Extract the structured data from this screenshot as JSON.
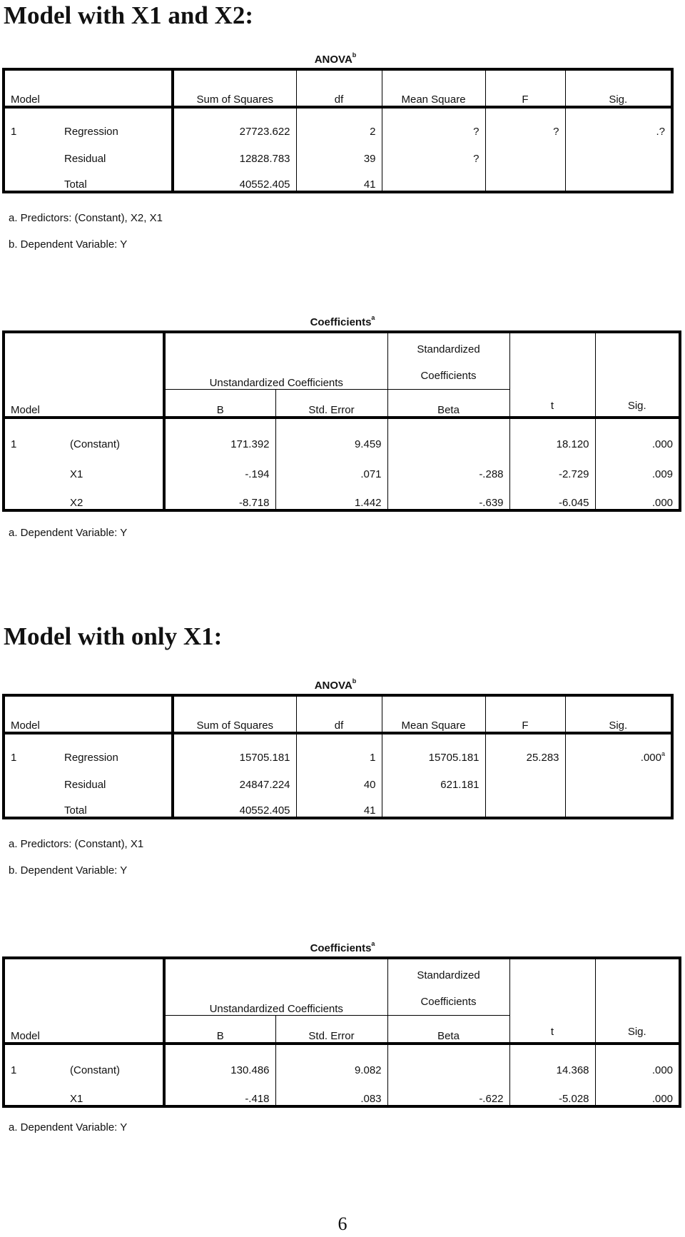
{
  "section1": {
    "heading": "Model with X1 and X2:",
    "anova": {
      "caption": "ANOVA",
      "caption_sup": "b",
      "headers": [
        "Model",
        "Sum of Squares",
        "df",
        "Mean Square",
        "F",
        "Sig."
      ],
      "rows": [
        {
          "model": "1",
          "term": "Regression",
          "ss": "27723.622",
          "df": "2",
          "ms": "?",
          "f": "?",
          "sig": ".?",
          "sig_sup": ""
        },
        {
          "model": "",
          "term": "Residual",
          "ss": "12828.783",
          "df": "39",
          "ms": "?",
          "f": "",
          "sig": "",
          "sig_sup": ""
        },
        {
          "model": "",
          "term": "Total",
          "ss": "40552.405",
          "df": "41",
          "ms": "",
          "f": "",
          "sig": "",
          "sig_sup": ""
        }
      ],
      "notes": [
        "a. Predictors: (Constant), X2, X1",
        "b. Dependent Variable: Y"
      ]
    },
    "coefficients": {
      "caption": "Coefficients",
      "caption_sup": "a",
      "group_headers": {
        "unstd": "Unstandardized Coefficients",
        "std_line1": "Standardized",
        "std_line2": "Coefficients"
      },
      "headers": [
        "Model",
        "B",
        "Std. Error",
        "Beta",
        "t",
        "Sig."
      ],
      "rows": [
        {
          "model": "1",
          "term": "(Constant)",
          "b": "171.392",
          "se": "9.459",
          "beta": "",
          "t": "18.120",
          "sig": ".000"
        },
        {
          "model": "",
          "term": "X1",
          "b": "-.194",
          "se": ".071",
          "beta": "-.288",
          "t": "-2.729",
          "sig": ".009"
        },
        {
          "model": "",
          "term": "X2",
          "b": "-8.718",
          "se": "1.442",
          "beta": "-.639",
          "t": "-6.045",
          "sig": ".000"
        }
      ],
      "notes": [
        "a. Dependent Variable: Y"
      ]
    }
  },
  "section2": {
    "heading": "Model with only X1:",
    "anova": {
      "caption": "ANOVA",
      "caption_sup": "b",
      "headers": [
        "Model",
        "Sum of Squares",
        "df",
        "Mean Square",
        "F",
        "Sig."
      ],
      "rows": [
        {
          "model": "1",
          "term": "Regression",
          "ss": "15705.181",
          "df": "1",
          "ms": "15705.181",
          "f": "25.283",
          "sig": ".000",
          "sig_sup": "a"
        },
        {
          "model": "",
          "term": "Residual",
          "ss": "24847.224",
          "df": "40",
          "ms": "621.181",
          "f": "",
          "sig": "",
          "sig_sup": ""
        },
        {
          "model": "",
          "term": "Total",
          "ss": "40552.405",
          "df": "41",
          "ms": "",
          "f": "",
          "sig": "",
          "sig_sup": ""
        }
      ],
      "notes": [
        "a. Predictors: (Constant), X1",
        "b. Dependent Variable: Y"
      ]
    },
    "coefficients": {
      "caption": "Coefficients",
      "caption_sup": "a",
      "group_headers": {
        "unstd": "Unstandardized Coefficients",
        "std_line1": "Standardized",
        "std_line2": "Coefficients"
      },
      "headers": [
        "Model",
        "B",
        "Std. Error",
        "Beta",
        "t",
        "Sig."
      ],
      "rows": [
        {
          "model": "1",
          "term": "(Constant)",
          "b": "130.486",
          "se": "9.082",
          "beta": "",
          "t": "14.368",
          "sig": ".000"
        },
        {
          "model": "",
          "term": "X1",
          "b": "-.418",
          "se": ".083",
          "beta": "-.622",
          "t": "-5.028",
          "sig": ".000"
        }
      ],
      "notes": [
        "a. Dependent Variable: Y"
      ]
    }
  },
  "page_number": "6"
}
